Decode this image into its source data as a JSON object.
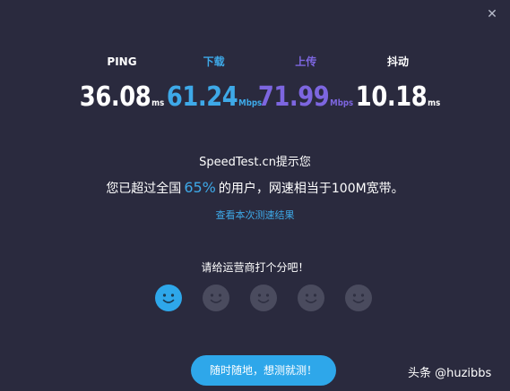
{
  "window": {
    "close_glyph": "✕"
  },
  "colors": {
    "background": "#2a2a3e",
    "ping": "#ffffff",
    "download": "#3ea9e8",
    "upload": "#7d66e0",
    "jitter": "#ffffff",
    "accent": "#2ea7ea",
    "face_active": "#2ea7ea",
    "face_inactive": "#4a4b5e"
  },
  "metrics": [
    {
      "label": "PING",
      "value": "36.08",
      "unit": "ms"
    },
    {
      "label": "下载",
      "value": "61.24",
      "unit": "Mbps"
    },
    {
      "label": "上传",
      "value": "71.99",
      "unit": "Mbps"
    },
    {
      "label": "抖动",
      "value": "10.18",
      "unit": "ms"
    }
  ],
  "prompt": {
    "title": "SpeedTest.cn提示您",
    "prefix": "您已超过全国",
    "percent": "65%",
    "suffix": "的用户，网速相当于100M宽带。",
    "result_link": "查看本次测速结果"
  },
  "rating": {
    "title": "请给运营商打个分吧！",
    "faces": [
      {
        "icon": "smiley-face-icon",
        "selected": true
      },
      {
        "icon": "smiley-face-icon",
        "selected": false
      },
      {
        "icon": "smiley-face-icon",
        "selected": false
      },
      {
        "icon": "smiley-face-icon",
        "selected": false
      },
      {
        "icon": "smiley-face-icon",
        "selected": false
      }
    ]
  },
  "action_button": {
    "label": "随时随地，想测就测！"
  },
  "watermark": {
    "text": "头条 @huzibbs"
  }
}
